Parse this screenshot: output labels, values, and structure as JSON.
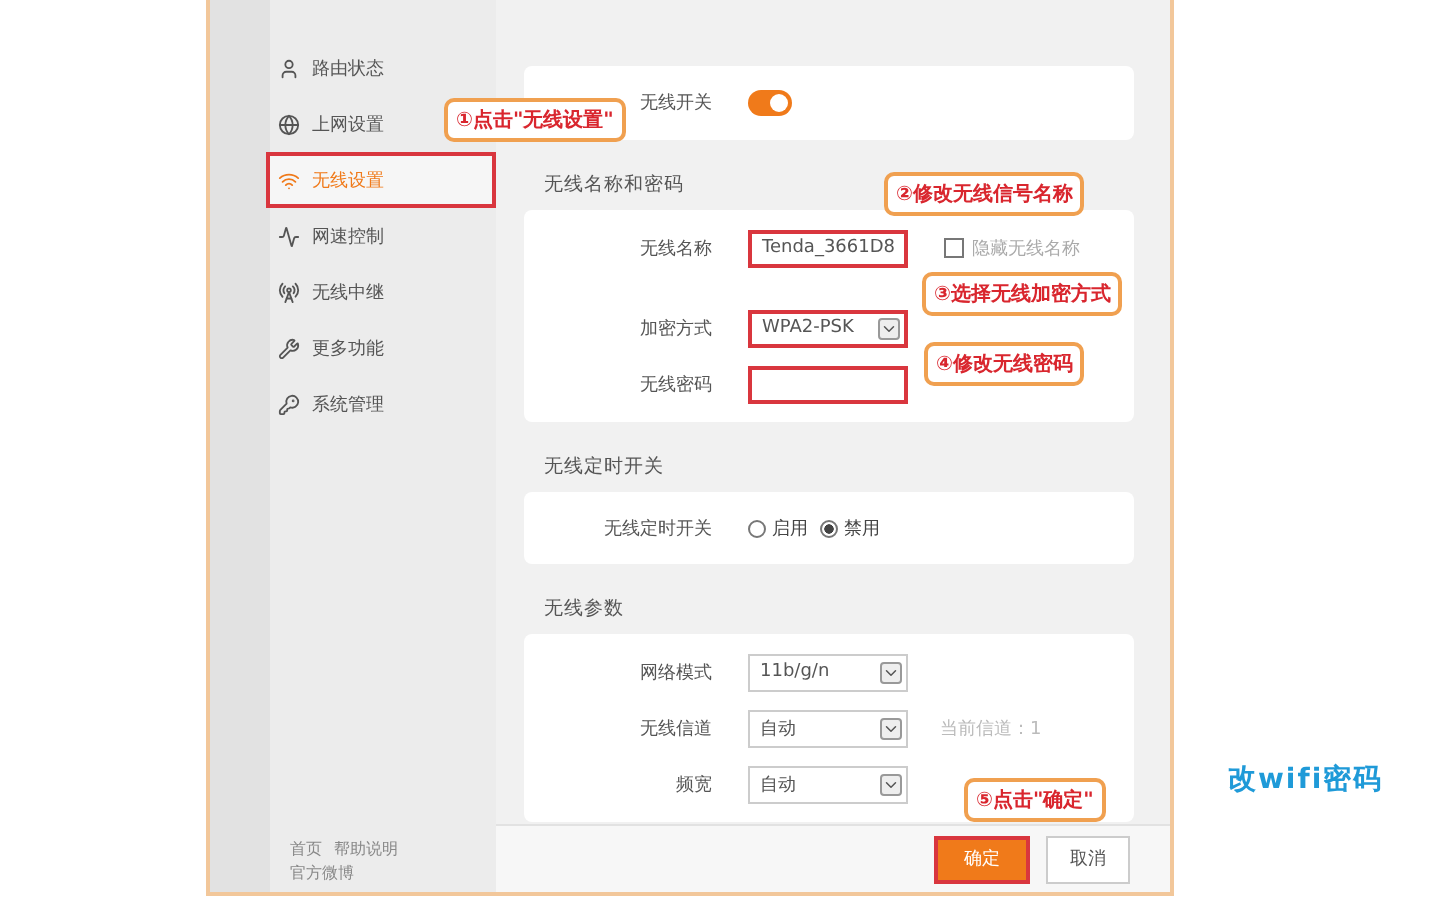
{
  "sidebar": {
    "items": [
      {
        "label": "路由状态",
        "selected": false,
        "highlight": false
      },
      {
        "label": "上网设置",
        "selected": false,
        "highlight": false
      },
      {
        "label": "无线设置",
        "selected": true,
        "highlight": true
      },
      {
        "label": "网速控制",
        "selected": false,
        "highlight": false
      },
      {
        "label": "无线中继",
        "selected": false,
        "highlight": false
      },
      {
        "label": "更多功能",
        "selected": false,
        "highlight": false
      },
      {
        "label": "系统管理",
        "selected": false,
        "highlight": false
      }
    ],
    "footer_links": [
      "首页",
      "帮助说明",
      "官方微博"
    ]
  },
  "wireless_switch": {
    "label": "无线开关",
    "on": true
  },
  "name_password": {
    "title": "无线名称和密码",
    "ssid": {
      "label": "无线名称",
      "value": "Tenda_3661D8",
      "highlight": true
    },
    "hide_ssid": {
      "label": "隐藏无线名称",
      "checked": false
    },
    "security": {
      "label": "加密方式",
      "value": "WPA2-PSK",
      "highlight": true
    },
    "password": {
      "label": "无线密码",
      "highlight": true
    }
  },
  "schedule": {
    "title": "无线定时开关",
    "label": "无线定时开关",
    "options": [
      {
        "label": "启用",
        "selected": false
      },
      {
        "label": "禁用",
        "selected": true
      }
    ]
  },
  "params": {
    "title": "无线参数",
    "rows": [
      {
        "label": "网络模式",
        "value": "11b/g/n"
      },
      {
        "label": "无线信道",
        "value": "自动",
        "hint": "当前信道：1"
      },
      {
        "label": "频宽",
        "value": "自动"
      }
    ]
  },
  "buttons": [
    {
      "label": "确定",
      "kind": "primary",
      "highlight": true
    },
    {
      "label": "取消",
      "kind": "secondary",
      "highlight": false
    }
  ],
  "callouts": [
    "①点击\"无线设置\"",
    "②修改无线信号名称",
    "③选择无线加密方式",
    "④修改无线密码",
    "⑤点击\"确定\""
  ],
  "caption": "改wifi密码"
}
